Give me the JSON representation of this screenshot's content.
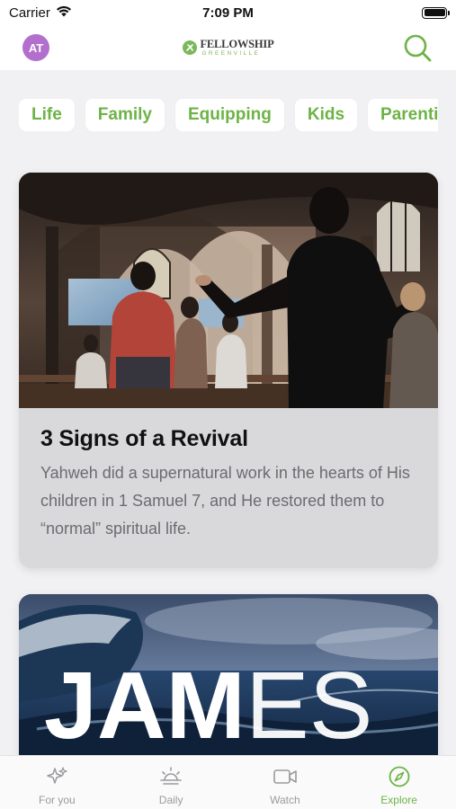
{
  "status_bar": {
    "carrier": "Carrier",
    "time": "7:09 PM",
    "icons": [
      "wifi-icon",
      "battery-icon"
    ]
  },
  "header": {
    "avatar_initials": "AT",
    "avatar_color": "#b26fcd",
    "logo_name": "FELLOWSHIP",
    "logo_sub": "GREENVILLE",
    "search_icon": "search-icon"
  },
  "categories": [
    "Life",
    "Family",
    "Equipping",
    "Kids",
    "Parenti"
  ],
  "articles": [
    {
      "title": "3 Signs of a Revival",
      "description": "Yahweh did a supernatural work in the hearts of His children in 1 Samuel 7, and He restored them to “normal” spiritual life."
    },
    {
      "cover_text_bold": "JAM",
      "cover_text_light": "ES"
    }
  ],
  "tabs": [
    {
      "label": "For you",
      "icon": "sparkle-icon",
      "active": false
    },
    {
      "label": "Daily",
      "icon": "sunrise-icon",
      "active": false
    },
    {
      "label": "Watch",
      "icon": "video-camera-icon",
      "active": false
    },
    {
      "label": "Explore",
      "icon": "compass-icon",
      "active": true
    }
  ],
  "colors": {
    "accent": "#6db346",
    "background": "#f1f1f3",
    "inactive_tab": "#9a9a9e"
  }
}
